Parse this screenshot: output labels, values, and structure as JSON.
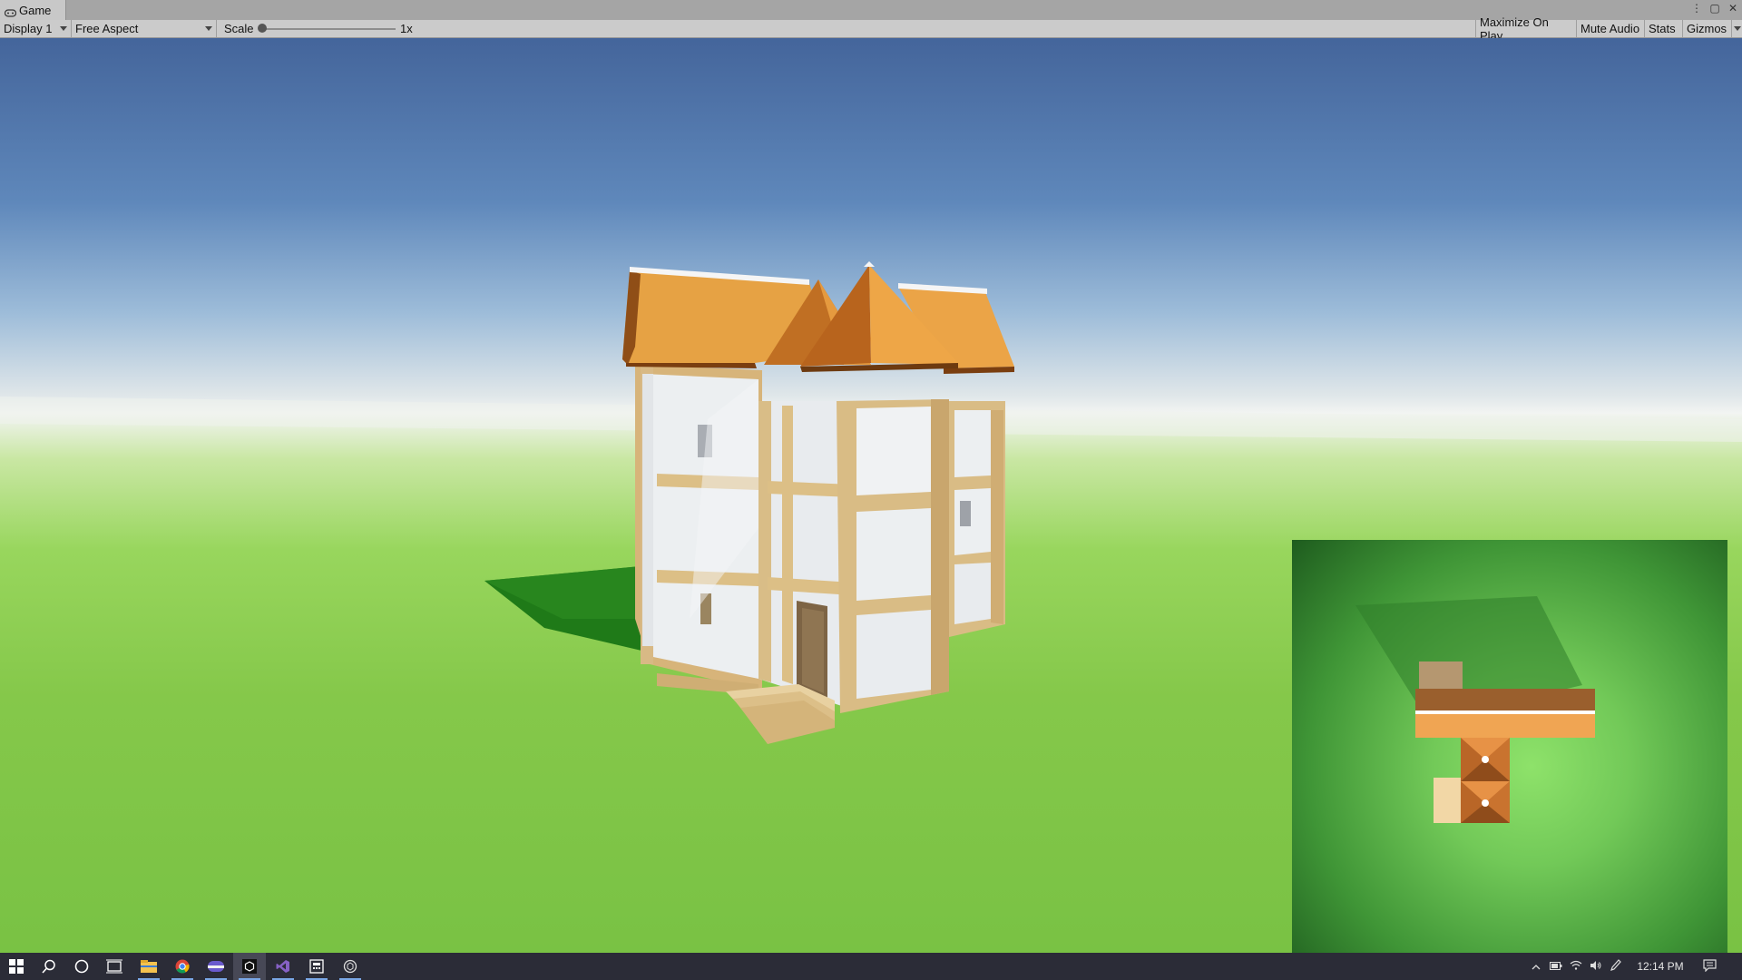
{
  "window": {
    "tab_title": "Game",
    "icon": "gamepad-icon",
    "controls": [
      "more-icon",
      "maximize-icon",
      "close-icon"
    ]
  },
  "toolbar": {
    "display": "Display 1",
    "aspect": "Free Aspect",
    "scale_label": "Scale",
    "scale_value": "1x",
    "scale_level": 0,
    "buttons": [
      "Maximize On Play",
      "Mute Audio",
      "Stats",
      "Gizmos"
    ]
  },
  "scene": {
    "sky_top": "#44659b",
    "horizon": "#f2f4f2",
    "ground": "#85c84a",
    "roof": "#e8a445",
    "wall": "#eceef0",
    "timber": "#dcc08a",
    "minimap_ground": "#72c958"
  },
  "taskbar": {
    "apps": [
      "windows-start-icon",
      "search-icon",
      "cortana-icon",
      "task-view-icon",
      "file-explorer-icon",
      "chrome-icon",
      "app-icon",
      "unity-icon",
      "visual-studio-icon",
      "calculator-icon",
      "unity-hub-icon"
    ],
    "tray_icons": [
      "chevron-up-icon",
      "battery-icon",
      "wifi-icon",
      "volume-icon",
      "pen-icon"
    ],
    "clock": "12:14 PM",
    "notification_icon": "notification-icon"
  }
}
